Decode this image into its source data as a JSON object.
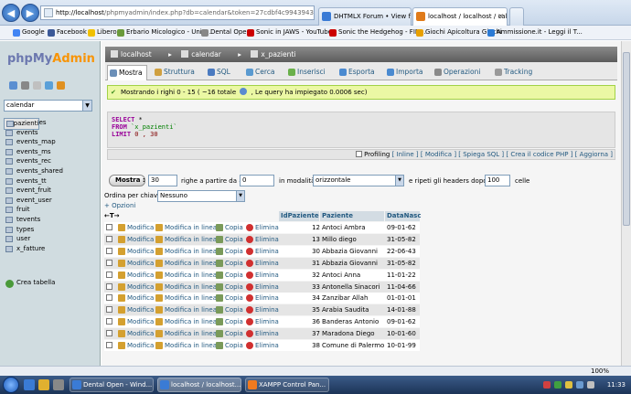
{
  "browser": {
    "url_prefix": "http://localhost",
    "url_rest": "/phpmyadmin/index.php?db=calendar&token=27cdbf4c9943943840",
    "tabs": [
      {
        "label": "DHTMLX Forum • View forum ..."
      },
      {
        "label": "localhost / localhost / calen..."
      }
    ],
    "favorites": [
      {
        "label": "Google"
      },
      {
        "label": "Facebook"
      },
      {
        "label": "Libero"
      },
      {
        "label": "Erbario Micologico - Univ..."
      },
      {
        "label": "Dental Open"
      },
      {
        "label": "Sonic in JAWS - YouTube"
      },
      {
        "label": "Sonic the Hedgehog - FIN..."
      },
      {
        "label": "Giochi Apicoltura Giochi"
      },
      {
        "label": "Ammissione.it - Leggi il T..."
      }
    ]
  },
  "sidebar": {
    "logo_php": "php",
    "logo_my": "My",
    "logo_admin": "Admin",
    "db_selected": "calendar",
    "tables": [
      "countries",
      "events",
      "events_map",
      "events_ms",
      "events_rec",
      "events_shared",
      "events_tt",
      "event_fruit",
      "event_user",
      "fruit",
      "tevents",
      "types",
      "user",
      "x_fatture",
      "x_pazienti"
    ],
    "create_table": "Crea tabella"
  },
  "breadcrumb": {
    "server": "localhost",
    "database": "calendar",
    "table": "x_pazienti"
  },
  "tabs": [
    "Mostra",
    "Struttura",
    "SQL",
    "Cerca",
    "Inserisci",
    "Esporta",
    "Importa",
    "Operazioni",
    "Tracking"
  ],
  "message": "Mostrando i righi 0 - 15 ( ~16 totale",
  "message_tail": ", Le query ha impiegato 0.0006 sec)",
  "sql": {
    "select": "SELECT",
    "star": " *",
    "from": "FROM",
    "table": " `x_pazienti`",
    "limit": "LIMIT",
    "range": " 0 , 30"
  },
  "sql_links": {
    "profiling": "Profiling",
    "inline": "[ Inline ]",
    "modifica": "[ Modifica ]",
    "spiega": "[ Spiega SQL ]",
    "codice": "[ Crea il codice PHP ]",
    "aggiorna": "[ Aggiorna ]"
  },
  "nav": {
    "show_button": "Mostra :",
    "rows_value": "30",
    "from_label": "righe a partire da #",
    "from_value": "0",
    "mode_label": "in modalità",
    "mode_value": "orizzontale",
    "repeat_label": "e ripeti gli headers dopo",
    "repeat_value": "100",
    "cells_label": "celle"
  },
  "sort": {
    "label": "Ordina per chiave:",
    "value": "Nessuno"
  },
  "options_link": "+ Opzioni",
  "columns": {
    "id": "IdPaziente",
    "name": "Paziente",
    "date": "DataNasc"
  },
  "actions": {
    "edit": "Modifica",
    "inline": "Modifica in linea",
    "copy": "Copia",
    "delete": "Elimina"
  },
  "rows": [
    {
      "id": "12",
      "name": "Antoci Ambra",
      "date": "09-01-62"
    },
    {
      "id": "13",
      "name": "Millo diego",
      "date": "31-05-82"
    },
    {
      "id": "30",
      "name": "Abbazia Giovanni",
      "date": "22-06-43"
    },
    {
      "id": "31",
      "name": "Abbazia Giovanni",
      "date": "31-05-82"
    },
    {
      "id": "32",
      "name": "Antoci Anna",
      "date": "11-01-22"
    },
    {
      "id": "33",
      "name": "Antonella Sinacori",
      "date": "11-04-66"
    },
    {
      "id": "34",
      "name": "Zanzibar Allah",
      "date": "01-01-01"
    },
    {
      "id": "35",
      "name": "Arabia Saudita",
      "date": "14-01-88"
    },
    {
      "id": "36",
      "name": "Banderas Antonio",
      "date": "09-01-62"
    },
    {
      "id": "37",
      "name": "Maradona Diego",
      "date": "10-01-60"
    },
    {
      "id": "38",
      "name": "Comune di Palermo",
      "date": "10-01-99"
    }
  ],
  "status": {
    "zoom": "100%"
  },
  "taskbar": {
    "items": [
      {
        "label": "Dental Open - Wind..."
      },
      {
        "label": "localhost / localhost..."
      },
      {
        "label": "XAMPP Control Pan..."
      }
    ],
    "clock": "11:33"
  }
}
